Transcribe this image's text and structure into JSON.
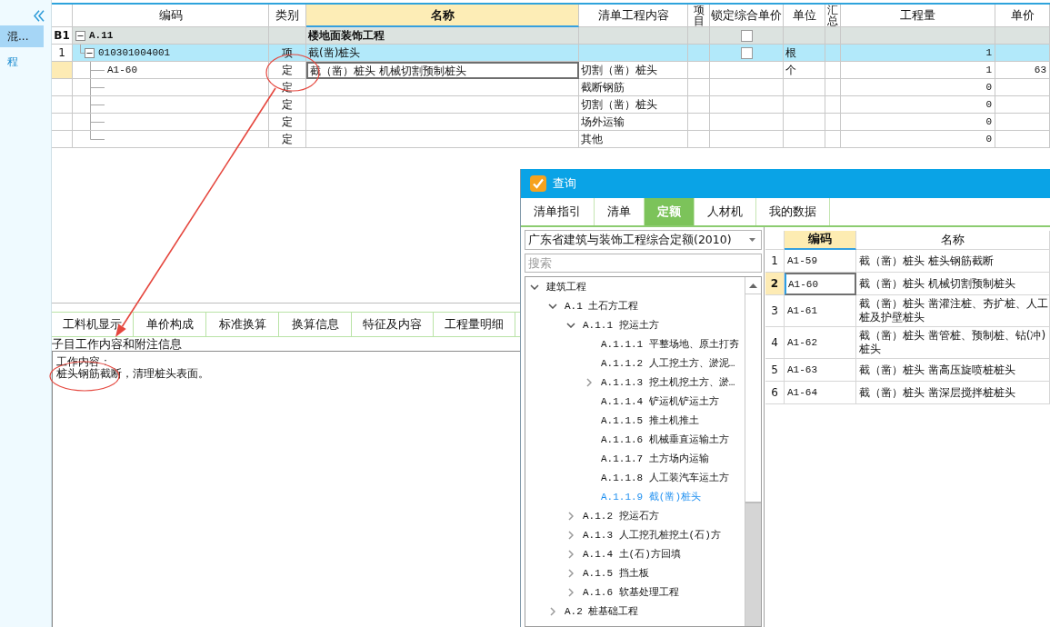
{
  "sidebar": {
    "items": [
      {
        "label": "混...",
        "selected": true
      },
      {
        "label": "程",
        "selected": false
      }
    ]
  },
  "main_table": {
    "columns": [
      {
        "label": "编码",
        "selected": false
      },
      {
        "label": "类别",
        "selected": false
      },
      {
        "label": "名称",
        "selected": true
      },
      {
        "label": "清单工程内容",
        "selected": false
      },
      {
        "label": "项目",
        "selected": false
      },
      {
        "label": "锁定综合单价",
        "selected": false
      },
      {
        "label": "单位",
        "selected": false
      },
      {
        "label": "汇总",
        "selected": false
      },
      {
        "label": "工程量",
        "selected": false
      },
      {
        "label": "单价",
        "selected": false
      }
    ],
    "rows": [
      {
        "kind": "section",
        "number": "B1",
        "code": "A.11",
        "expanded": true,
        "name": "楼地面装饰工程",
        "lock_price": {
          "checked": false
        },
        "selected": false,
        "children": [
          {
            "kind": "item",
            "number": "1",
            "code": "010301004001",
            "expanded": true,
            "category": "项",
            "name": "截(凿)桩头",
            "lock_price": {
              "checked": false
            },
            "unit": "根",
            "quantity": "1",
            "selected": false,
            "children": [
              {
                "kind": "quota",
                "code": "A1-60",
                "category": "定",
                "name": "截（凿）桩头 机械切割预制桩头",
                "content": "切割（凿）桩头",
                "unit": "个",
                "quantity": "1",
                "unit_price": "63",
                "selected": true
              },
              {
                "kind": "quota",
                "category": "定",
                "content": "截断钢筋",
                "quantity": "0",
                "selected": false
              },
              {
                "kind": "quota",
                "category": "定",
                "content": "切割（凿）桩头",
                "quantity": "0",
                "selected": false
              },
              {
                "kind": "quota",
                "category": "定",
                "content": "场外运输",
                "quantity": "0",
                "selected": false
              },
              {
                "kind": "quota",
                "category": "定",
                "content": "其他",
                "quantity": "0",
                "selected": false
              }
            ]
          }
        ]
      }
    ]
  },
  "query_dialog": {
    "title": "查询",
    "tabs": [
      {
        "label": "清单指引",
        "selected": false
      },
      {
        "label": "清单",
        "selected": false
      },
      {
        "label": "定额",
        "selected": true
      },
      {
        "label": "人材机",
        "selected": false
      },
      {
        "label": "我的数据",
        "selected": false
      }
    ],
    "library_dropdown": {
      "value": "广东省建筑与装饰工程综合定额(2010)"
    },
    "search": {
      "placeholder": "搜索"
    },
    "tree": [
      {
        "label": "建筑工程",
        "kind": "group",
        "expanded": true,
        "selected": false,
        "children": [
          {
            "label": "A.1 土石方工程",
            "kind": "group",
            "expanded": true,
            "selected": false,
            "children": [
              {
                "label": "A.1.1 挖运土方",
                "kind": "group",
                "expanded": true,
                "selected": false,
                "children": [
                  {
                    "label": "A.1.1.1 平整场地、原土打夯",
                    "kind": "leaf",
                    "selected": false
                  },
                  {
                    "label": "A.1.1.2 人工挖土方、淤泥…",
                    "kind": "leaf",
                    "selected": false
                  },
                  {
                    "label": "A.1.1.3 挖土机挖土方、淤…",
                    "kind": "group",
                    "expanded": false,
                    "selected": false
                  },
                  {
                    "label": "A.1.1.4 铲运机铲运土方",
                    "kind": "leaf",
                    "selected": false
                  },
                  {
                    "label": "A.1.1.5 推土机推土",
                    "kind": "leaf",
                    "selected": false
                  },
                  {
                    "label": "A.1.1.6 机械垂直运输土方",
                    "kind": "leaf",
                    "selected": false
                  },
                  {
                    "label": "A.1.1.7 土方场内运输",
                    "kind": "leaf",
                    "selected": false
                  },
                  {
                    "label": "A.1.1.8 人工装汽车运土方",
                    "kind": "leaf",
                    "selected": false
                  },
                  {
                    "label": "A.1.1.9 截(凿)桩头",
                    "kind": "leaf",
                    "selected": true
                  }
                ]
              },
              {
                "label": "A.1.2 挖运石方",
                "kind": "group",
                "expanded": false,
                "selected": false
              },
              {
                "label": "A.1.3 人工挖孔桩挖土(石)方",
                "kind": "group",
                "expanded": false,
                "selected": false
              },
              {
                "label": "A.1.4 土(石)方回填",
                "kind": "group",
                "expanded": false,
                "selected": false
              },
              {
                "label": "A.1.5 挡土板",
                "kind": "group",
                "expanded": false,
                "selected": false
              },
              {
                "label": "A.1.6 软基处理工程",
                "kind": "group",
                "expanded": false,
                "selected": false
              }
            ]
          },
          {
            "label": "A.2 桩基础工程",
            "kind": "group",
            "expanded": false,
            "selected": false
          }
        ]
      }
    ],
    "results": {
      "columns": [
        {
          "label": "编码",
          "selected": true
        },
        {
          "label": "名称",
          "selected": false
        }
      ],
      "rows": [
        {
          "number": "1",
          "code": "A1-59",
          "name_lines": [
            "截（凿）桩头 桩头钢筋截断"
          ],
          "selected": false
        },
        {
          "number": "2",
          "code": "A1-60",
          "name_lines": [
            "截（凿）桩头 机械切割预制桩头"
          ],
          "selected": true
        },
        {
          "number": "3",
          "code": "A1-61",
          "name_lines": [
            "截（凿）桩头 凿灌注桩、夯扩桩、人工",
            "桩及护壁桩头"
          ],
          "selected": false
        },
        {
          "number": "4",
          "code": "A1-62",
          "name_lines": [
            "截（凿）桩头 凿管桩、预制桩、钻(冲)",
            "桩头"
          ],
          "selected": false
        },
        {
          "number": "5",
          "code": "A1-63",
          "name_lines": [
            "截（凿）桩头 凿高压旋喷桩桩头"
          ],
          "selected": false
        },
        {
          "number": "6",
          "code": "A1-64",
          "name_lines": [
            "截（凿）桩头 凿深层搅拌桩桩头"
          ],
          "selected": false
        }
      ]
    }
  },
  "bottom_panel": {
    "tabs": [
      {
        "label": "工料机显示",
        "selected": false
      },
      {
        "label": "单价构成",
        "selected": false
      },
      {
        "label": "标准换算",
        "selected": false
      },
      {
        "label": "换算信息",
        "selected": false
      },
      {
        "label": "特征及内容",
        "selected": false
      },
      {
        "label": "工程量明细",
        "selected": false
      }
    ],
    "caption": "子目工作内容和附注信息",
    "notes": {
      "lines": [
        "工作内容：",
        "桩头钢筋截断，清理桩头表面。"
      ]
    }
  }
}
